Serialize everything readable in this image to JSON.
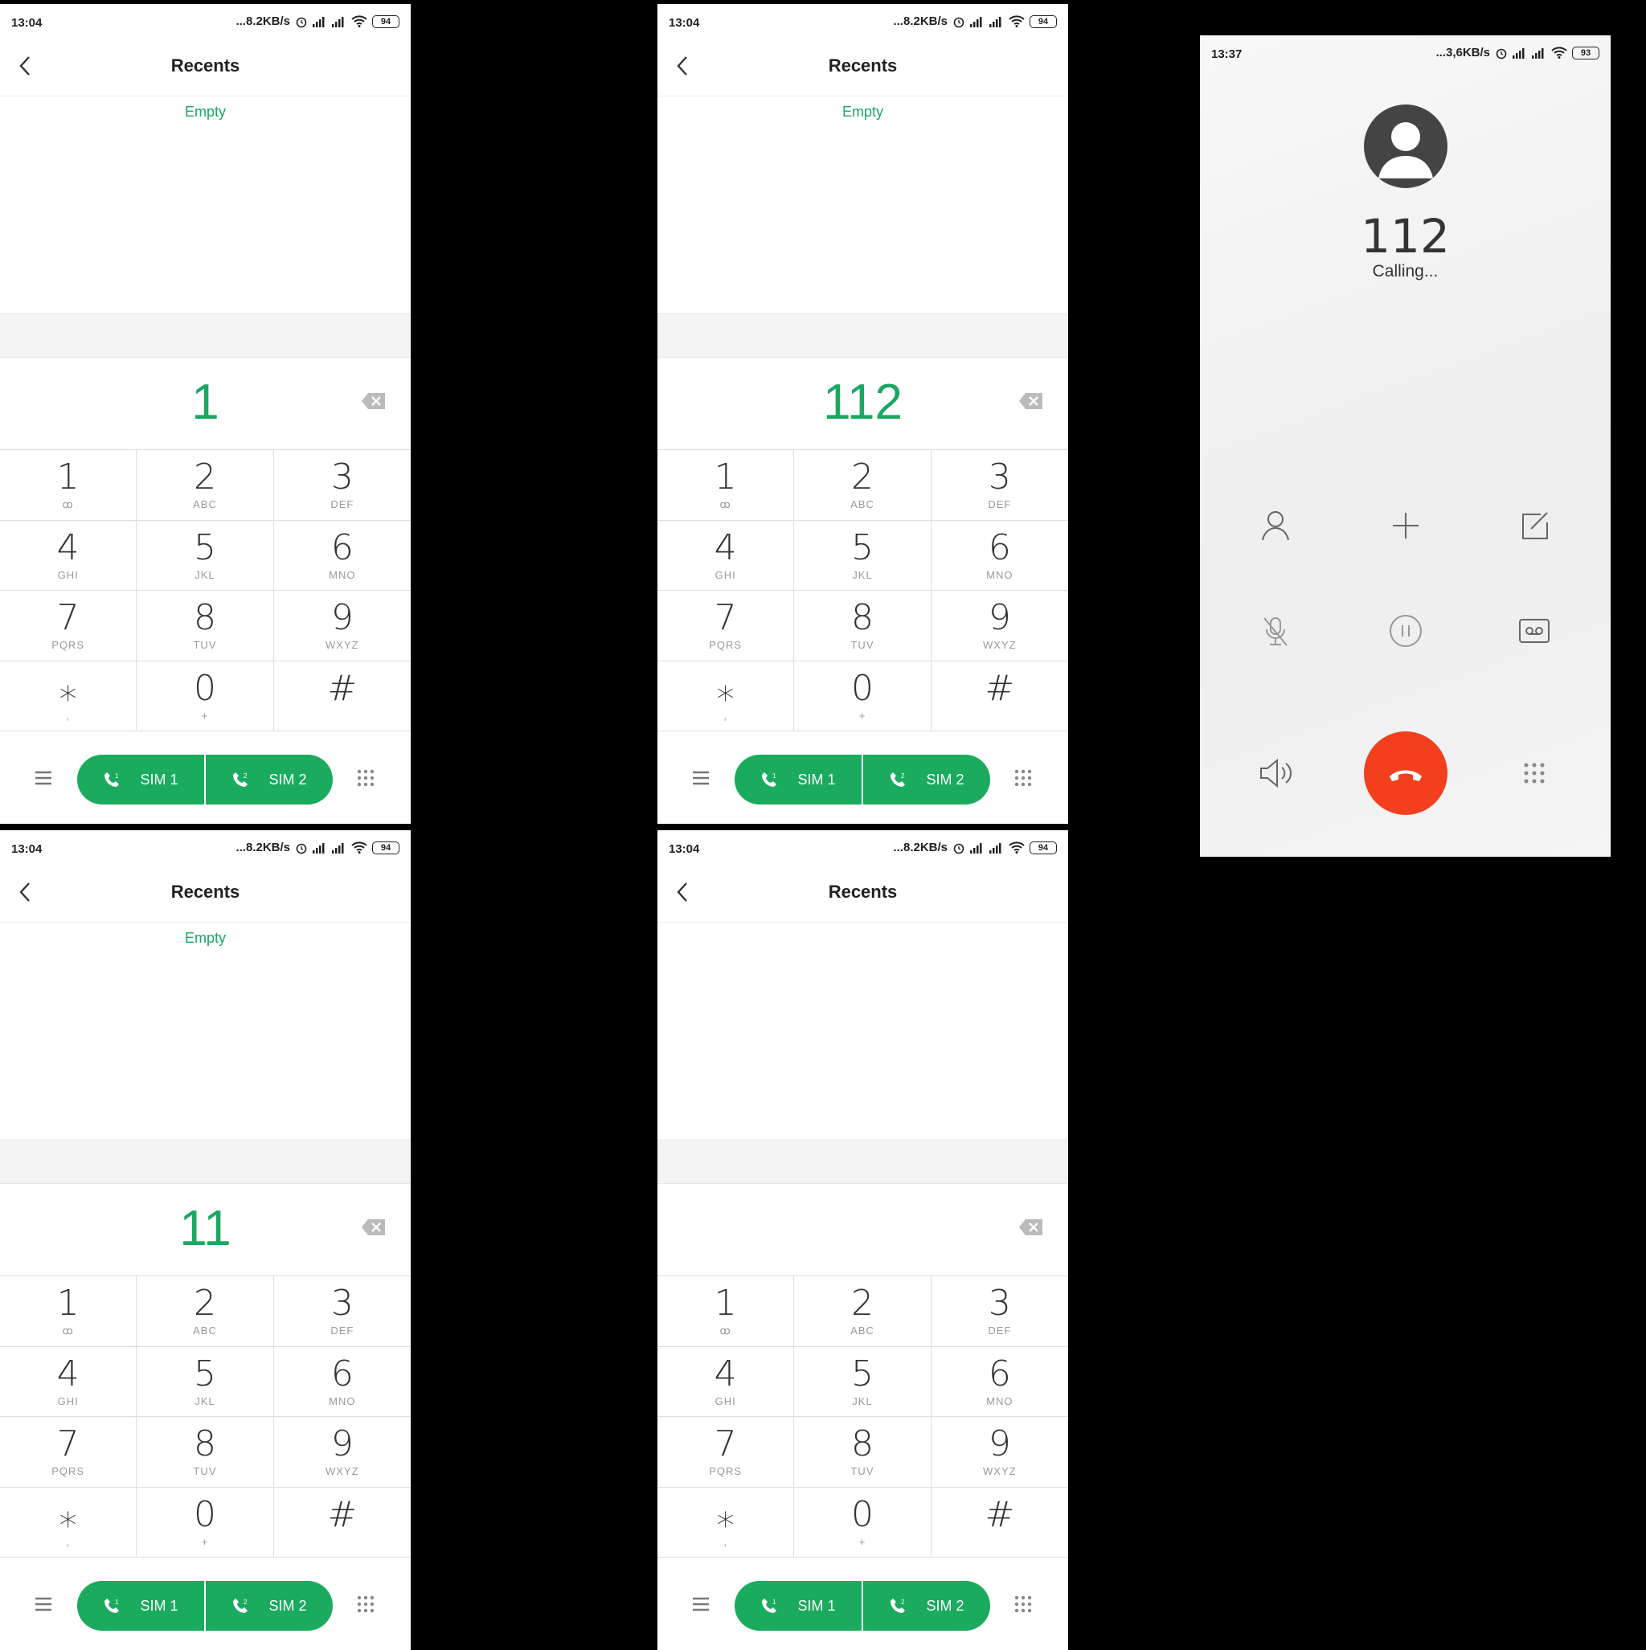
{
  "dialer": {
    "time": "13:04",
    "speed": "...8.2KB/s",
    "battery": "94",
    "title": "Recents",
    "empty_text": "Empty",
    "keys": [
      {
        "digit": "1",
        "letters": "ꝏ"
      },
      {
        "digit": "2",
        "letters": "ABC"
      },
      {
        "digit": "3",
        "letters": "DEF"
      },
      {
        "digit": "4",
        "letters": "GHI"
      },
      {
        "digit": "5",
        "letters": "JKL"
      },
      {
        "digit": "6",
        "letters": "MNO"
      },
      {
        "digit": "7",
        "letters": "PQRS"
      },
      {
        "digit": "8",
        "letters": "TUV"
      },
      {
        "digit": "9",
        "letters": "WXYZ"
      },
      {
        "digit": "⁎",
        "letters": ","
      },
      {
        "digit": "0",
        "letters": "+"
      },
      {
        "digit": "#",
        "letters": ""
      }
    ],
    "sim1_label": "SIM 1",
    "sim2_label": "SIM 2"
  },
  "screens": [
    {
      "number": "1",
      "show_empty": true
    },
    {
      "number": "112",
      "show_empty": true
    },
    {
      "number": "11",
      "show_empty": true
    },
    {
      "number": "",
      "show_empty": false
    }
  ],
  "call": {
    "time": "13:37",
    "speed": "...3,6KB/s",
    "battery": "93",
    "number": "112",
    "status": "Calling..."
  },
  "colors": {
    "accent": "#1aa862",
    "end_call": "#f2401f"
  }
}
